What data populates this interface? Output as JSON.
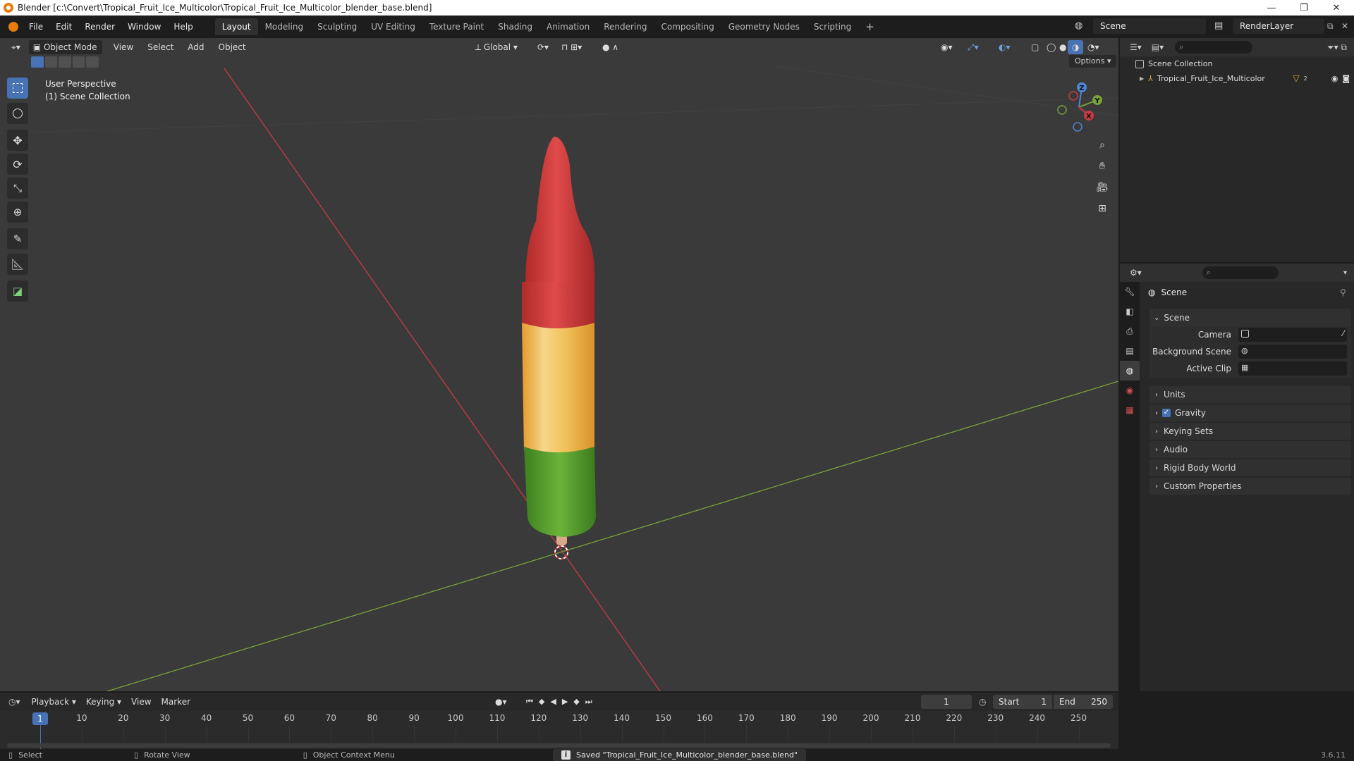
{
  "window": {
    "title": "Blender [c:\\Convert\\Tropical_Fruit_Ice_Multicolor\\Tropical_Fruit_Ice_Multicolor_blender_base.blend]",
    "minimize": "—",
    "maximize": "❐",
    "close": "✕"
  },
  "menu": [
    "File",
    "Edit",
    "Render",
    "Window",
    "Help"
  ],
  "workspaces": [
    "Layout",
    "Modeling",
    "Sculpting",
    "UV Editing",
    "Texture Paint",
    "Shading",
    "Animation",
    "Rendering",
    "Compositing",
    "Geometry Nodes",
    "Scripting"
  ],
  "workspace_add": "+",
  "scene_name": "Scene",
  "render_layer": "RenderLayer",
  "viewport": {
    "mode": "Object Mode",
    "menus": [
      "View",
      "Select",
      "Add",
      "Object"
    ],
    "transform_orientation": "Global",
    "options": "Options",
    "info_line1": "User Perspective",
    "info_line2": "(1) Scene Collection",
    "gizmo": {
      "z": "Z",
      "y": "Y",
      "x": "X"
    }
  },
  "outliner": {
    "root": "Scene Collection",
    "object": "Tropical_Fruit_Ice_Multicolor",
    "object_badge": "2"
  },
  "properties": {
    "context": "Scene",
    "panel_title": "Scene",
    "camera_label": "Camera",
    "background_scene_label": "Background Scene",
    "active_clip_label": "Active Clip",
    "sections": [
      "Units",
      "Gravity",
      "Keying Sets",
      "Audio",
      "Rigid Body World",
      "Custom Properties"
    ],
    "gravity_checked": true
  },
  "timeline": {
    "menus": [
      "Playback",
      "Keying",
      "View",
      "Marker"
    ],
    "current_frame": "1",
    "start_label": "Start",
    "start": "1",
    "end_label": "End",
    "end": "250",
    "ruler": [
      "10",
      "20",
      "30",
      "40",
      "50",
      "60",
      "70",
      "80",
      "90",
      "100",
      "110",
      "120",
      "130",
      "140",
      "150",
      "160",
      "170",
      "180",
      "190",
      "200",
      "210",
      "220",
      "230",
      "240",
      "250"
    ],
    "playhead": "1"
  },
  "status": {
    "select": "Select",
    "rotate": "Rotate View",
    "context_menu": "Object Context Menu",
    "message": "Saved \"Tropical_Fruit_Ice_Multicolor_blender_base.blend\"",
    "version": "3.6.11"
  },
  "colors": {
    "accent": "#4772b3",
    "x_axis": "#c73b45",
    "y_axis": "#7aa03a",
    "popsicle_red": "#d23a3a",
    "popsicle_yellow": "#f0b94a",
    "popsicle_green": "#5aa030",
    "stick": "#d8a98a"
  }
}
